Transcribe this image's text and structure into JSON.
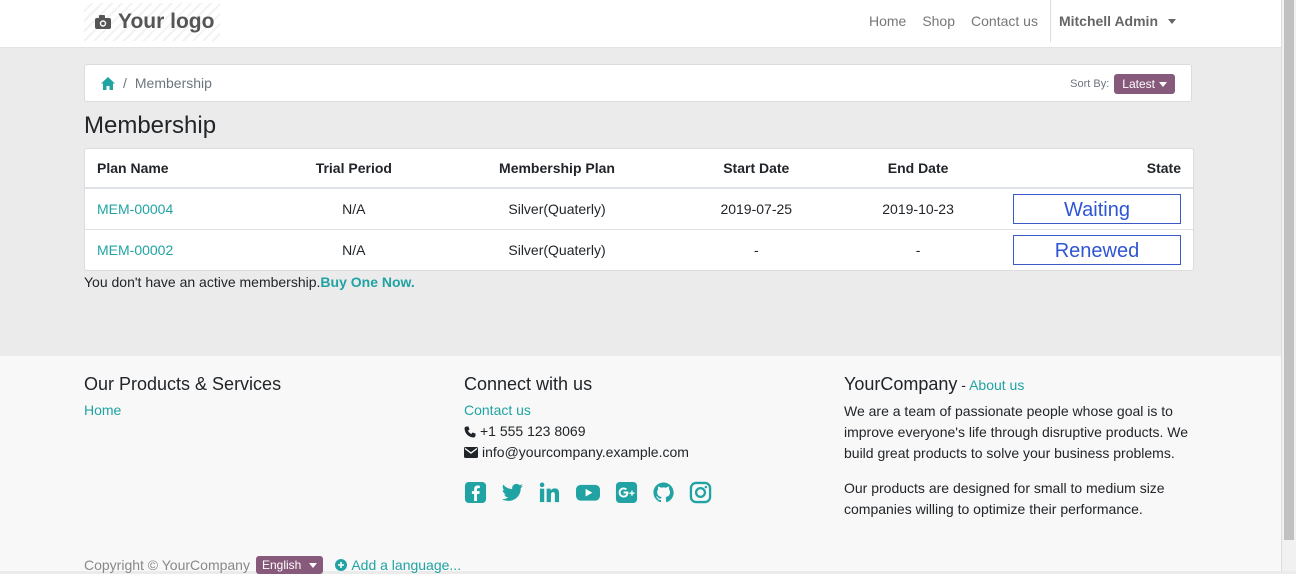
{
  "nav": {
    "logo": "Your logo",
    "links": [
      "Home",
      "Shop",
      "Contact us"
    ],
    "user": "Mitchell Admin"
  },
  "breadcrumb": {
    "current": "Membership"
  },
  "sort": {
    "label": "Sort By:",
    "value": "Latest"
  },
  "page_title": "Membership",
  "table": {
    "headers": [
      "Plan Name",
      "Trial Period",
      "Membership Plan",
      "Start Date",
      "End Date",
      "State"
    ],
    "rows": [
      {
        "plan": "MEM-00004",
        "trial": "N/A",
        "membership_plan": "Silver(Quaterly)",
        "start": "2019-07-25",
        "end": "2019-10-23",
        "state": "Waiting"
      },
      {
        "plan": "MEM-00002",
        "trial": "N/A",
        "membership_plan": "Silver(Quaterly)",
        "start": "-",
        "end": "-",
        "state": "Renewed"
      }
    ]
  },
  "notice": {
    "text": "You don't have an active membership.",
    "link": "Buy One Now."
  },
  "footer": {
    "col1": {
      "title": "Our Products & Services",
      "link": "Home"
    },
    "col2": {
      "title": "Connect with us",
      "link": "Contact us",
      "phone": "+1 555 123 8069",
      "email": "info@yourcompany.example.com"
    },
    "col3": {
      "title": "YourCompany",
      "sep": " - ",
      "link": "About us",
      "para1": "We are a team of passionate people whose goal is to improve everyone's life through disruptive products. We build great products to solve your business problems.",
      "para2": "Our products are designed for small to medium size companies willing to optimize their performance."
    },
    "copyright": "Copyright © YourCompany",
    "language": "English",
    "add_language": "Add a language..."
  },
  "colors": {
    "accent": "#21a3a3",
    "primary": "#875a7b",
    "state_border": "#3a5bc7"
  }
}
